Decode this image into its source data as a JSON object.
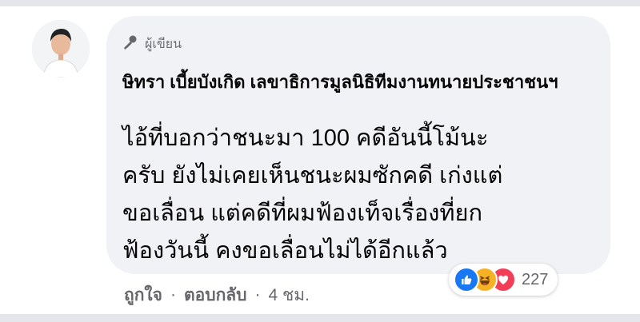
{
  "author_badge": {
    "icon": "microphone-icon",
    "label": "ผู้เขียน"
  },
  "comment": {
    "author": "ษิทรา เบี้ยบังเกิด เลขาธิการมูลนิธิทีมงานทนายประชาชนฯ",
    "lines": [
      "ไอ้ที่บอกว่าชนะมา 100 คดีอันนี้โม้นะ",
      "ครับ ยังไม่เคยเห็นชนะผมซักคดี เก่งแต่",
      "ขอเลื่อน แต่คดีที่ผมฟ้องเท็จเรื่องที่ยก",
      "ฟ้องวันนี้ คงขอเลื่อนไม่ได้อีกแล้ว"
    ]
  },
  "reactions": {
    "icons": [
      "like-icon",
      "haha-icon",
      "love-icon"
    ],
    "colors": {
      "like": "#1877f2",
      "haha": "#f7b125",
      "love": "#f33e58"
    },
    "count": "227"
  },
  "actions": {
    "like": "ถูกใจ",
    "reply": "ตอบกลับ",
    "separator": "·",
    "time": "4 ชม."
  }
}
